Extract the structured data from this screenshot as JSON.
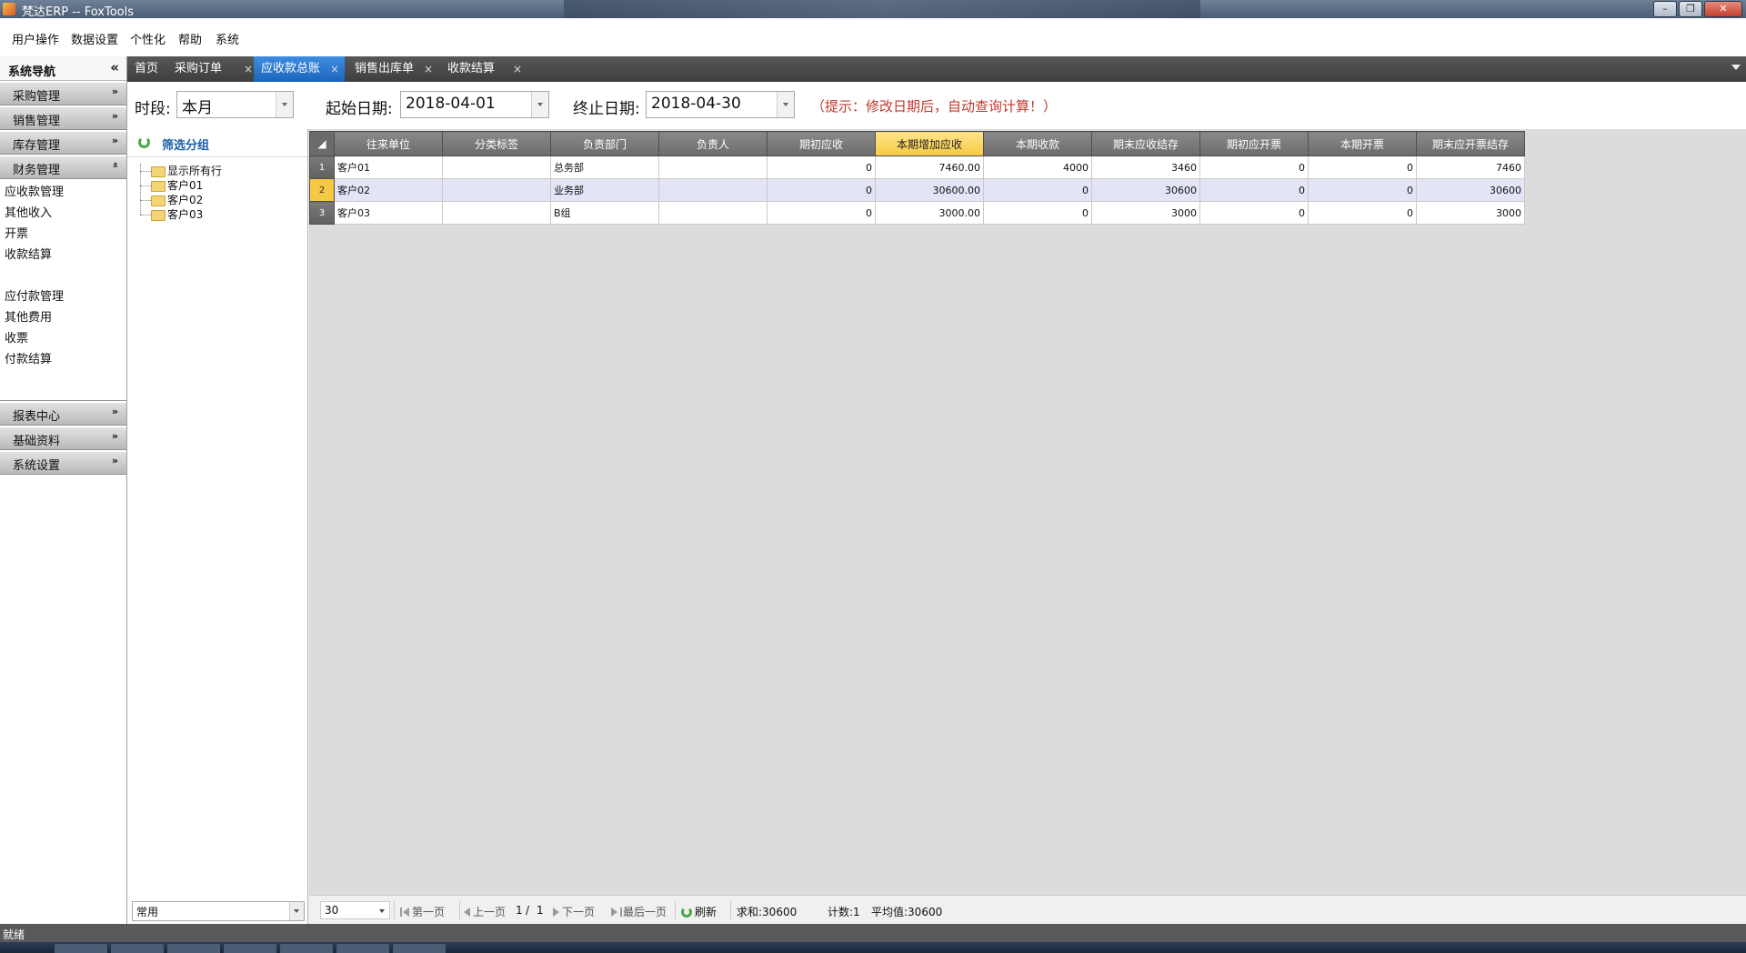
{
  "window": {
    "title": "梵达ERP -- FoxTools"
  },
  "menu": [
    "用户操作",
    "数据设置",
    "个性化",
    "帮助",
    "系统"
  ],
  "sidebar": {
    "title": "系统导航",
    "collapse_glyph": "«",
    "groups_top": [
      "采购管理",
      "销售管理",
      "库存管理"
    ],
    "expanded_group": "财务管理",
    "sub_items_a": [
      "应收款管理",
      "其他收入",
      "开票",
      "收款结算"
    ],
    "sub_items_b": [
      "应付款管理",
      "其他费用",
      "收票",
      "付款结算"
    ],
    "groups_bottom": [
      "报表中心",
      "基础资料",
      "系统设置"
    ]
  },
  "tabs": {
    "home": "首页",
    "t1": "采购订单",
    "t2": "应收款总账",
    "t3": "销售出库单",
    "t4": "收款结算",
    "close_glyph": "×"
  },
  "filter": {
    "period_label": "时段:",
    "period_value": "本月",
    "start_label": "起始日期:",
    "start_value": "2018-04-01",
    "end_label": "终止日期:",
    "end_value": "2018-04-30",
    "hint": "（提示：修改日期后，自动查询计算！）"
  },
  "group_panel": {
    "title": "筛选分组",
    "tree": [
      "显示所有行",
      "客户01",
      "客户02",
      "客户03"
    ],
    "footer_value": "常用"
  },
  "grid": {
    "columns": [
      "往来单位",
      "分类标签",
      "负责部门",
      "负责人",
      "期初应收",
      "本期增加应收",
      "本期收款",
      "期末应收结存",
      "期初应开票",
      "本期开票",
      "期末应开票结存"
    ],
    "rows": [
      [
        "1",
        "客户01",
        "",
        "总务部",
        "",
        "0",
        "7460.00",
        "4000",
        "3460",
        "0",
        "0",
        "7460"
      ],
      [
        "2",
        "客户02",
        "",
        "业务部",
        "",
        "0",
        "30600.00",
        "0",
        "30600",
        "0",
        "0",
        "30600"
      ],
      [
        "3",
        "客户03",
        "",
        "B组",
        "",
        "0",
        "3000.00",
        "0",
        "3000",
        "0",
        "0",
        "3000"
      ]
    ]
  },
  "pager": {
    "page_size": "30",
    "first": "第一页",
    "prev": "上一页",
    "page": "1",
    "slash": "/",
    "total": "1",
    "next": "下一页",
    "last": "最后一页",
    "refresh": "刷新",
    "sum": "求和:30600",
    "count": "计数:1",
    "avg": "平均值:30600"
  },
  "status": {
    "text": "就绪"
  },
  "colors": {
    "active_tab": "#1c64bb",
    "highlight_header": "#f5c943",
    "hint_text": "#c0392b",
    "selected_row": "#e4e4f7"
  }
}
